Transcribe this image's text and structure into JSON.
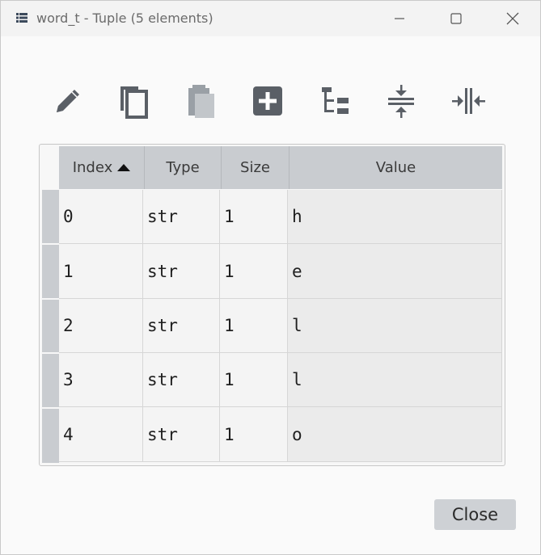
{
  "window": {
    "title": "word_t - Tuple (5 elements)",
    "icon": "list-table-icon"
  },
  "window_controls": [
    "minimize-icon",
    "maximize-icon",
    "close-icon"
  ],
  "toolbar": {
    "buttons": [
      {
        "name": "edit-button",
        "icon": "pencil-icon"
      },
      {
        "name": "copy-button",
        "icon": "copy-icon"
      },
      {
        "name": "paste-button",
        "icon": "paste-icon"
      },
      {
        "name": "insert-button",
        "icon": "plus-square-icon"
      },
      {
        "name": "tree-view-button",
        "icon": "tree-icon"
      },
      {
        "name": "collapse-rows-button",
        "icon": "collapse-vertical-icon"
      },
      {
        "name": "collapse-columns-button",
        "icon": "collapse-horizontal-icon"
      }
    ]
  },
  "table": {
    "columns": [
      {
        "label": "Index",
        "sorted": "ascending"
      },
      {
        "label": "Type"
      },
      {
        "label": "Size"
      },
      {
        "label": "Value"
      }
    ],
    "rows": [
      {
        "index": "0",
        "type": "str",
        "size": "1",
        "value": "h"
      },
      {
        "index": "1",
        "type": "str",
        "size": "1",
        "value": "e"
      },
      {
        "index": "2",
        "type": "str",
        "size": "1",
        "value": "l"
      },
      {
        "index": "3",
        "type": "str",
        "size": "1",
        "value": "l"
      },
      {
        "index": "4",
        "type": "str",
        "size": "1",
        "value": "o"
      }
    ]
  },
  "footer": {
    "close_label": "Close"
  },
  "colors": {
    "header_bg": "#c9ccd0",
    "icon": "#5a5f66"
  }
}
